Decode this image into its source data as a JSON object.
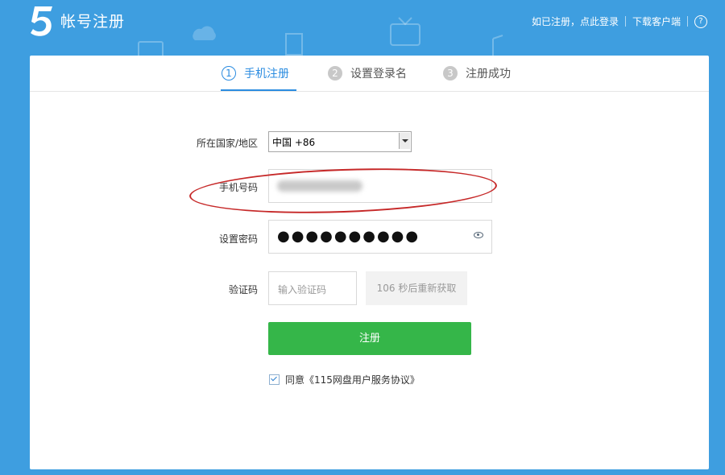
{
  "header": {
    "title": "帐号注册",
    "login_link": "如已注册，点此登录",
    "download_link": "下载客户端",
    "help": "?"
  },
  "steps": [
    {
      "num": "1",
      "label": "手机注册"
    },
    {
      "num": "2",
      "label": "设置登录名"
    },
    {
      "num": "3",
      "label": "注册成功"
    }
  ],
  "form": {
    "country_label": "所在国家/地区",
    "country_value": "中国 +86",
    "phone_label": "手机号码",
    "password_label": "设置密码",
    "password_value": "●●●●●●●●●●",
    "code_label": "验证码",
    "code_placeholder": "输入验证码",
    "resend_label": "106 秒后重新获取",
    "submit_label": "注册",
    "agree_label": "同意《115网盘用户服务协议》"
  },
  "colors": {
    "background": "#3e9ee0",
    "accent": "#2b8ce0",
    "submit": "#35b649",
    "annotation": "#c62828"
  }
}
